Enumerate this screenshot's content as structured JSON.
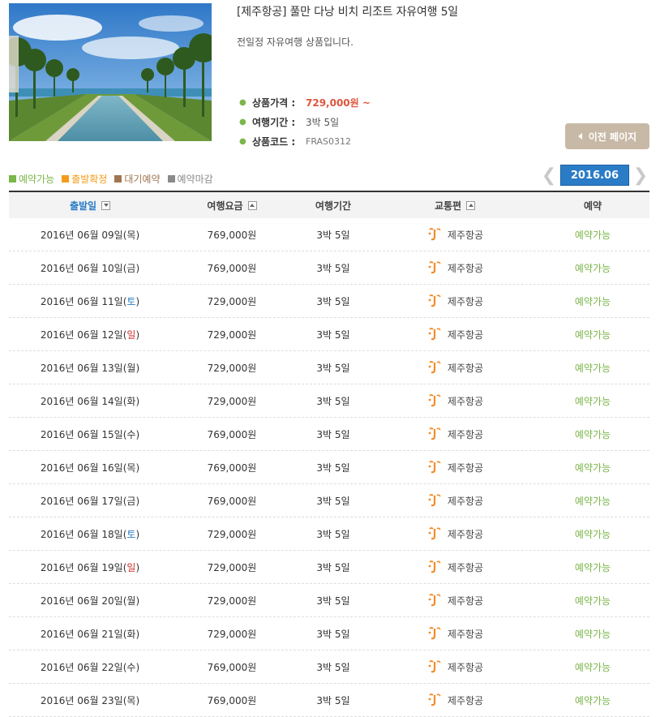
{
  "product": {
    "title": "[제주항공] 풀만 다낭 비치 리조트 자유여행 5일",
    "description": "전일정 자유여행 상품입니다.",
    "price_label": "상품가격 :",
    "price_value": "729,000원 ~",
    "period_label": "여행기간 :",
    "period_value": "3박 5일",
    "code_label": "상품코드 :",
    "code_value": "FRAS0312"
  },
  "prev_button": "이전 페이지",
  "legend": [
    {
      "label": "예약가능",
      "color": "#7ab648"
    },
    {
      "label": "출발확정",
      "color": "#f39c1b"
    },
    {
      "label": "대기예약",
      "color": "#a07650"
    },
    {
      "label": "예약마감",
      "color": "#8a8a8a"
    }
  ],
  "month": "2016.06",
  "table": {
    "headers": [
      "출발일",
      "여행요금",
      "여행기간",
      "교통편",
      "예약"
    ],
    "rows": [
      {
        "date": "2016년 06월 09일(",
        "day": "목",
        "end": ")",
        "price": "769,000원",
        "period": "3박 5일",
        "airline": "제주항공",
        "status": "예약가능"
      },
      {
        "date": "2016년 06월 10일(",
        "day": "금",
        "end": ")",
        "price": "769,000원",
        "period": "3박 5일",
        "airline": "제주항공",
        "status": "예약가능"
      },
      {
        "date": "2016년 06월 11일(",
        "day": "토",
        "end": ")",
        "price": "729,000원",
        "period": "3박 5일",
        "airline": "제주항공",
        "status": "예약가능"
      },
      {
        "date": "2016년 06월 12일(",
        "day": "일",
        "end": ")",
        "price": "729,000원",
        "period": "3박 5일",
        "airline": "제주항공",
        "status": "예약가능"
      },
      {
        "date": "2016년 06월 13일(",
        "day": "월",
        "end": ")",
        "price": "729,000원",
        "period": "3박 5일",
        "airline": "제주항공",
        "status": "예약가능"
      },
      {
        "date": "2016년 06월 14일(",
        "day": "화",
        "end": ")",
        "price": "729,000원",
        "period": "3박 5일",
        "airline": "제주항공",
        "status": "예약가능"
      },
      {
        "date": "2016년 06월 15일(",
        "day": "수",
        "end": ")",
        "price": "769,000원",
        "period": "3박 5일",
        "airline": "제주항공",
        "status": "예약가능"
      },
      {
        "date": "2016년 06월 16일(",
        "day": "목",
        "end": ")",
        "price": "769,000원",
        "period": "3박 5일",
        "airline": "제주항공",
        "status": "예약가능"
      },
      {
        "date": "2016년 06월 17일(",
        "day": "금",
        "end": ")",
        "price": "769,000원",
        "period": "3박 5일",
        "airline": "제주항공",
        "status": "예약가능"
      },
      {
        "date": "2016년 06월 18일(",
        "day": "토",
        "end": ")",
        "price": "729,000원",
        "period": "3박 5일",
        "airline": "제주항공",
        "status": "예약가능"
      },
      {
        "date": "2016년 06월 19일(",
        "day": "일",
        "end": ")",
        "price": "729,000원",
        "period": "3박 5일",
        "airline": "제주항공",
        "status": "예약가능"
      },
      {
        "date": "2016년 06월 20일(",
        "day": "월",
        "end": ")",
        "price": "729,000원",
        "period": "3박 5일",
        "airline": "제주항공",
        "status": "예약가능"
      },
      {
        "date": "2016년 06월 21일(",
        "day": "화",
        "end": ")",
        "price": "729,000원",
        "period": "3박 5일",
        "airline": "제주항공",
        "status": "예약가능"
      },
      {
        "date": "2016년 06월 22일(",
        "day": "수",
        "end": ")",
        "price": "769,000원",
        "period": "3박 5일",
        "airline": "제주항공",
        "status": "예약가능"
      },
      {
        "date": "2016년 06월 23일(",
        "day": "목",
        "end": ")",
        "price": "769,000원",
        "period": "3박 5일",
        "airline": "제주항공",
        "status": "예약가능"
      }
    ]
  }
}
